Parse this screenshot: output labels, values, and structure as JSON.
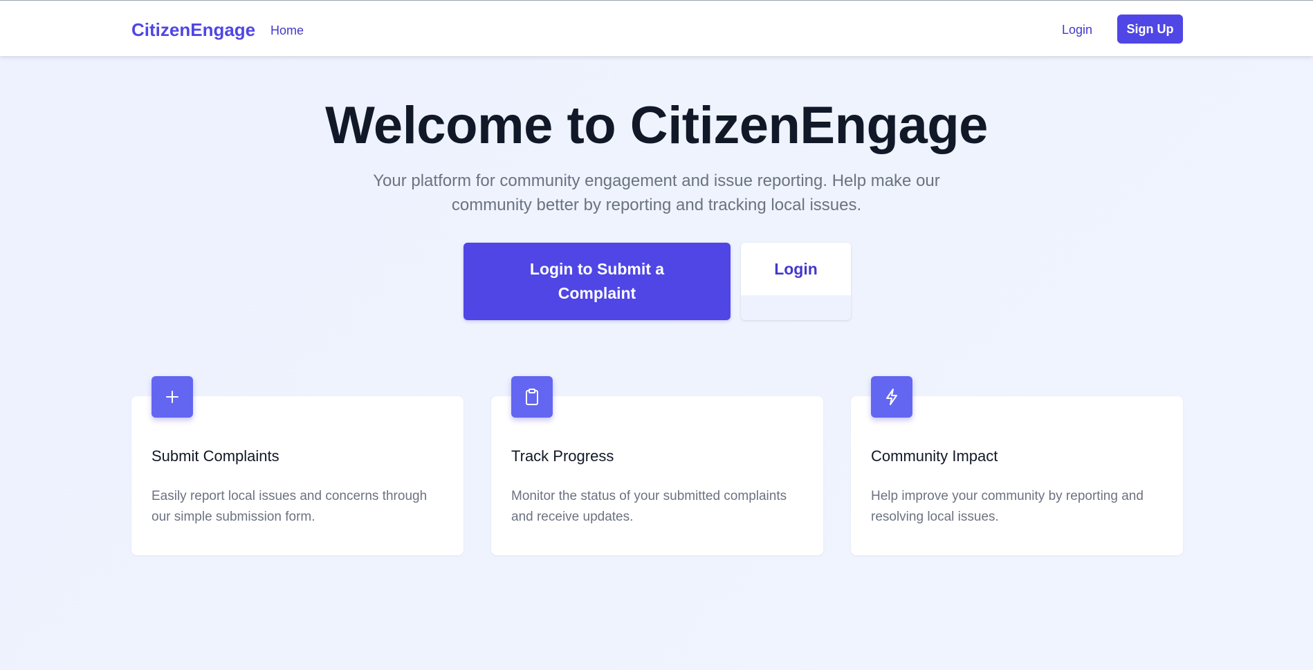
{
  "nav": {
    "brand": "CitizenEngage",
    "home_label": "Home",
    "login_label": "Login",
    "signup_label": "Sign Up"
  },
  "hero": {
    "title": "Welcome to CitizenEngage",
    "subtitle": "Your platform for community engagement and issue reporting. Help make our community better by reporting and tracking local issues.",
    "primary_cta": "Login to Submit a Complaint",
    "secondary_cta": "Login"
  },
  "features": [
    {
      "icon": "plus-icon",
      "title": "Submit Complaints",
      "description": "Easily report local issues and concerns through our simple submission form."
    },
    {
      "icon": "clipboard-icon",
      "title": "Track Progress",
      "description": "Monitor the status of your submitted complaints and receive updates."
    },
    {
      "icon": "lightning-icon",
      "title": "Community Impact",
      "description": "Help improve your community by reporting and resolving local issues."
    }
  ],
  "colors": {
    "accent": "#4f46e5",
    "icon_bg": "#6366f1",
    "text_dark": "#111827",
    "text_muted": "#6b7280"
  }
}
